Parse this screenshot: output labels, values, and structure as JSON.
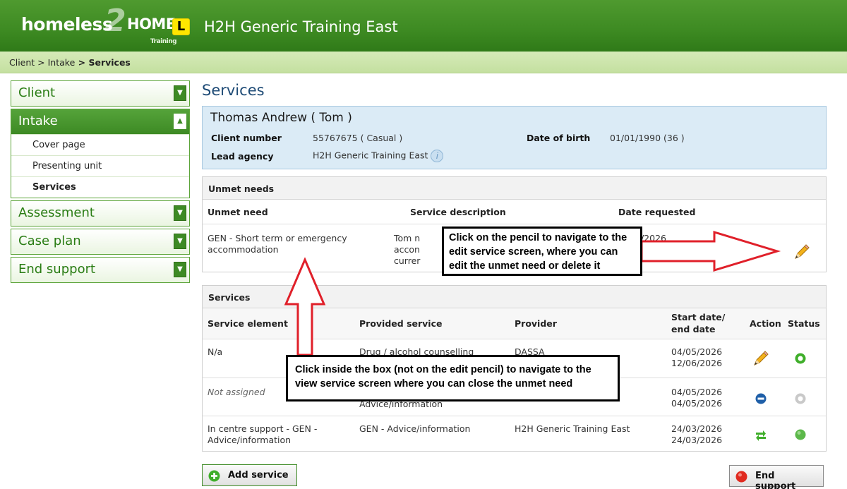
{
  "header": {
    "logo_left": "homeless",
    "logo_two": "2",
    "logo_right": "HOME",
    "logo_sub": "Training",
    "plate": "L",
    "title": "H2H Generic Training East"
  },
  "breadcrumb": {
    "part1": "Client",
    "sep1": " > ",
    "part2": "Intake",
    "sep2": " > ",
    "current": "Services"
  },
  "sidebar": {
    "client": "Client",
    "intake": "Intake",
    "intake_items": [
      "Cover page",
      "Presenting unit",
      "Services"
    ],
    "assessment": "Assessment",
    "case_plan": "Case plan",
    "end_support": "End support"
  },
  "page_title": "Services",
  "client": {
    "name": "Thomas Andrew ( Tom )",
    "number_label": "Client number",
    "number_value": "55767675 ( Casual )",
    "dob_label": "Date of birth",
    "dob_value": "01/01/1990 (36 )",
    "agency_label": "Lead agency",
    "agency_value": "H2H Generic Training East",
    "info_glyph": "i"
  },
  "unmet": {
    "title": "Unmet needs",
    "col_need": "Unmet need",
    "col_desc": "Service description",
    "col_date": "Date requested",
    "row_need": "GEN - Short term or emergency accommodation",
    "row_desc_lines": [
      "Tom n",
      "accon",
      "currer"
    ],
    "row_date": "./2026"
  },
  "services": {
    "title": "Services",
    "col_element": "Service element",
    "col_provided": "Provided service",
    "col_provider": "Provider",
    "col_dates": "Start date/ end date",
    "col_action": "Action",
    "col_status": "Status",
    "rows": [
      {
        "element": "N/a",
        "provided": "Drug / alcohol counselling",
        "provider": "DASSA",
        "start": "04/05/2026",
        "end": "12/06/2026"
      },
      {
        "element": "Not assigned",
        "provided": "Advice/information",
        "provider": "",
        "start": "04/05/2026",
        "end": "04/05/2026"
      },
      {
        "element": "In centre support - GEN - Advice/information",
        "provided": "GEN - Advice/information",
        "provider": "H2H Generic Training East",
        "start": "24/03/2026",
        "end": "24/03/2026"
      }
    ]
  },
  "buttons": {
    "add_service": "Add service",
    "end_support": "End support"
  },
  "callouts": {
    "pencil": "Click on the pencil to navigate to the edit service screen, where you can edit the unmet need or delete it",
    "box": "Click inside the box (not on the edit pencil) to navigate to the view service screen where you can close the unmet need"
  },
  "colors": {
    "header_green": "#3d8a22",
    "nav_green": "#2a7d14",
    "client_box": "#dbebf6",
    "title_blue": "#1d4a75",
    "arrow_red": "#e0202a"
  },
  "icons": [
    "pencil-icon",
    "status-open-icon",
    "status-closed-icon",
    "action-minus-icon",
    "action-transfer-icon",
    "status-complete-icon",
    "plus-icon",
    "stop-icon",
    "info-icon",
    "chevron-down-icon",
    "chevron-up-icon"
  ]
}
